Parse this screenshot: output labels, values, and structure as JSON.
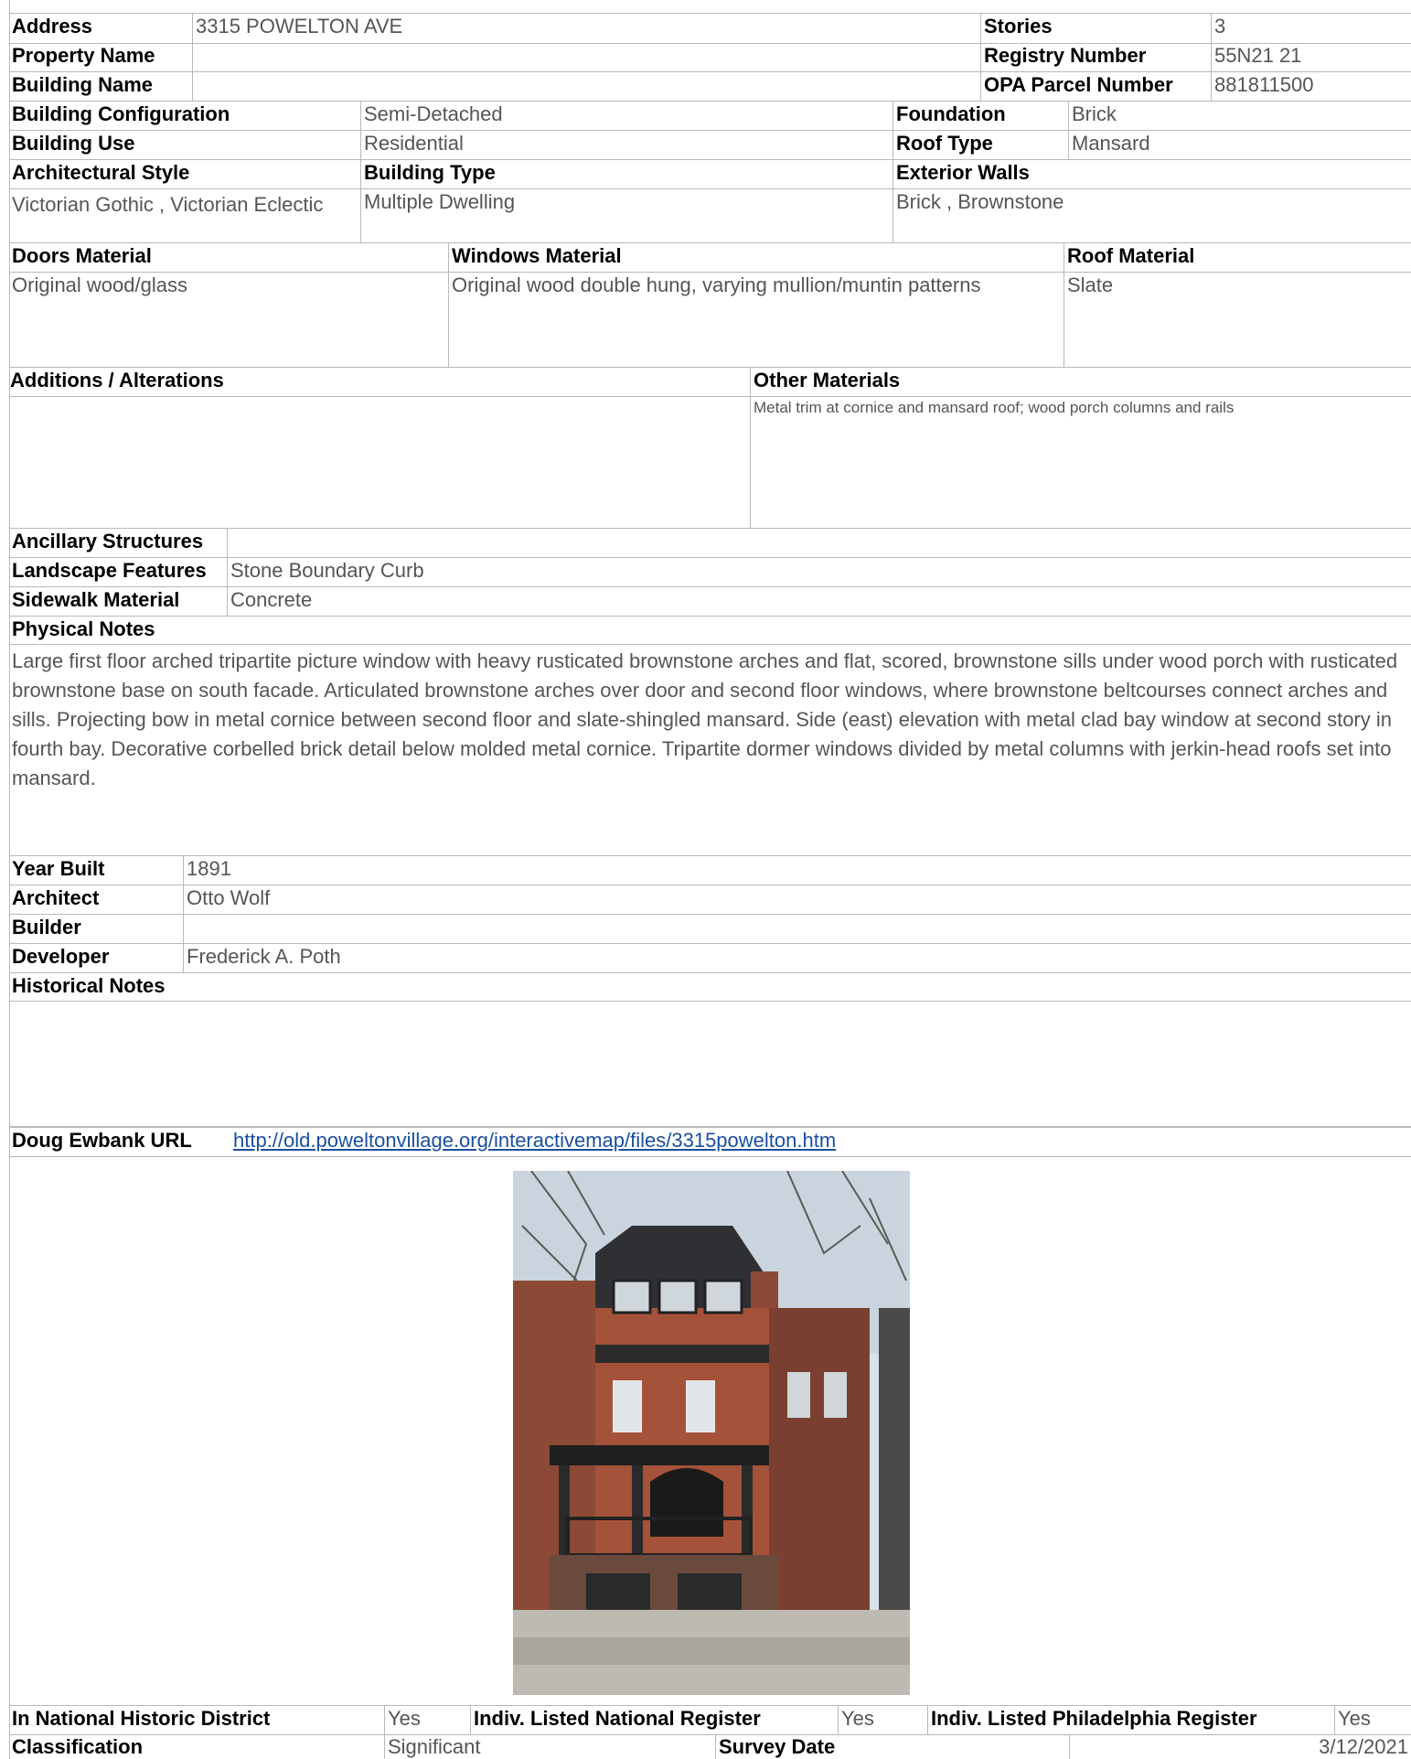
{
  "identity": {
    "address_label": "Address",
    "address": "3315 POWELTON AVE",
    "stories_label": "Stories",
    "stories": "3",
    "property_name_label": "Property Name",
    "property_name": "",
    "registry_label": "Registry Number",
    "registry": "55N21 21",
    "building_name_label": "Building Name",
    "building_name": "",
    "opa_label": "OPA Parcel Number",
    "opa": "881811500"
  },
  "building": {
    "config_label": "Building Configuration",
    "config": "Semi-Detached",
    "foundation_label": "Foundation",
    "foundation": "Brick",
    "use_label": "Building Use",
    "use": "Residential",
    "roof_type_label": "Roof Type",
    "roof_type": "Mansard",
    "style_label": "Architectural Style",
    "style": "Victorian Gothic , Victorian Eclectic",
    "type_label": "Building Type",
    "type": "Multiple Dwelling",
    "walls_label": "Exterior Walls",
    "walls": "Brick , Brownstone"
  },
  "materials": {
    "doors_label": "Doors Material",
    "doors": "Original wood/glass",
    "windows_label": "Windows Material",
    "windows": "Original wood double hung, varying mullion/muntin patterns",
    "roof_label": "Roof Material",
    "roof": "Slate",
    "additions_label": "Additions / Alterations",
    "additions": "",
    "other_label": "Other Materials",
    "other": "Metal trim at cornice and mansard roof; wood porch columns and rails"
  },
  "site": {
    "ancillary_label": "Ancillary Structures",
    "ancillary": "",
    "landscape_label": "Landscape Features",
    "landscape": "Stone Boundary Curb",
    "sidewalk_label": "Sidewalk Material",
    "sidewalk": "Concrete"
  },
  "physical": {
    "label": "Physical Notes",
    "text": "Large first floor arched tripartite picture window with heavy rusticated brownstone arches and flat, scored, brownstone sills under wood porch with rusticated brownstone base on south facade. Articulated brownstone arches over door and second floor windows, where brownstone beltcourses connect arches and sills. Projecting bow in metal cornice between second floor and slate-shingled mansard. Side (east) elevation with metal clad bay window at second story in fourth bay. Decorative corbelled brick detail below molded metal cornice. Tripartite dormer windows divided by metal columns with jerkin-head roofs set into mansard."
  },
  "history": {
    "year_label": "Year Built",
    "year": "1891",
    "architect_label": "Architect",
    "architect": "Otto Wolf",
    "builder_label": "Builder",
    "builder": "",
    "developer_label": "Developer",
    "developer": "Frederick A. Poth",
    "notes_label": "Historical Notes",
    "notes": "",
    "url_label": "Doug Ewbank URL",
    "url": "http://old.poweltonvillage.org/interactivemap/files/3315powelton.htm"
  },
  "status": {
    "district_label": "In National Historic District",
    "district": "Yes",
    "national_label": "Indiv. Listed National Register",
    "national": "Yes",
    "phila_label": "Indiv. Listed Philadelphia Register",
    "phila": "Yes",
    "class_label": "Classification",
    "class": "Significant",
    "survey_label": "Survey Date",
    "survey": "3/12/2021"
  }
}
